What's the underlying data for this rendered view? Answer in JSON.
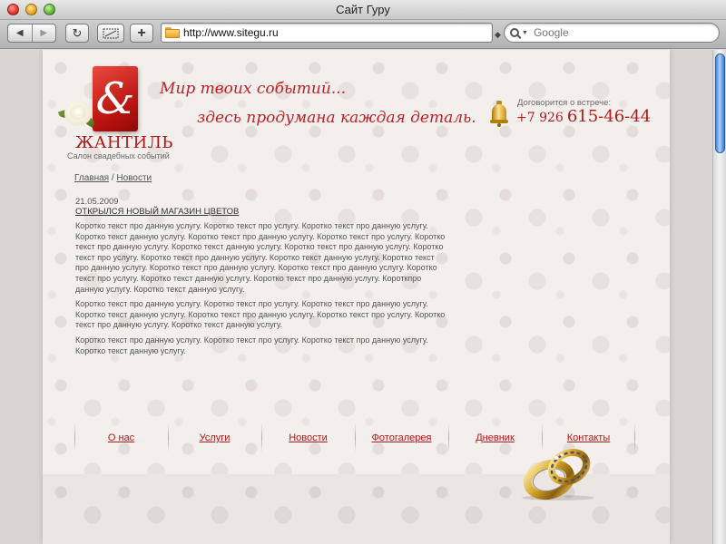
{
  "browser": {
    "window_title": "Сайт Гуру",
    "address_url": "http://www.sitegu.ru",
    "search_placeholder": "Google",
    "add_tab_label": "+"
  },
  "site": {
    "logo_monogram": "&",
    "brand_name": "ЖАНТИЛЬ",
    "brand_subtitle": "Салон свадебных событий",
    "slogan_line1": "Мир твоих событий...",
    "slogan_line2": "здесь продумана каждая деталь.",
    "contact_label": "Договорится о встрече:",
    "phone_code": "+7 926",
    "phone_number": "615-46-44"
  },
  "breadcrumb": {
    "home": "Главная",
    "separator": " / ",
    "current": "Новости"
  },
  "news": {
    "date": "21.05.2009",
    "title": "ОТКРЫЛСЯ НОВЫЙ МАГАЗИН ЦВЕТОВ",
    "paragraphs": [
      "Коротко текст про данную услугу.  Коротко текст про услугу. Коротко текст про данную услугу. Коротко текст данную услугу. Коротко текст про данную услугу.  Коротко текст про услугу. Коротко текст про данную услугу.  Коротко текст данную услугу. Коротко текст про данную услугу.  Коротко текст про услугу. Коротко текст про данную услугу.  Коротко текст данную услугу. Коротко текст про данную услугу.  Коротко текст про данную услугу.  Коротко текст про данную услугу.  Коротко текст про услугу. Коротко текст данную услугу. Коротко текст про данную услугу.  Короткпро данную услугу.  Коротко текст данную услугу.",
      "Коротко текст про данную услугу.  Коротко текст про услугу. Коротко текст про данную услугу. Коротко текст данную услугу. Коротко текст про данную услугу.  Коротко текст про услугу. Коротко текст про данную услугу.  Коротко текст данную услугу.",
      "Коротко текст про данную услугу.  Коротко текст про услугу. Коротко текст про данную услугу. Коротко текст данную услугу."
    ]
  },
  "footer_nav": [
    "О нас",
    "Услуги",
    "Новости",
    "Фотогалерея",
    "Дневник",
    "Контакты"
  ],
  "colors": {
    "accent_red": "#b3171a",
    "page_background": "#f3efec",
    "scroll_thumb": "#4a86d4"
  }
}
